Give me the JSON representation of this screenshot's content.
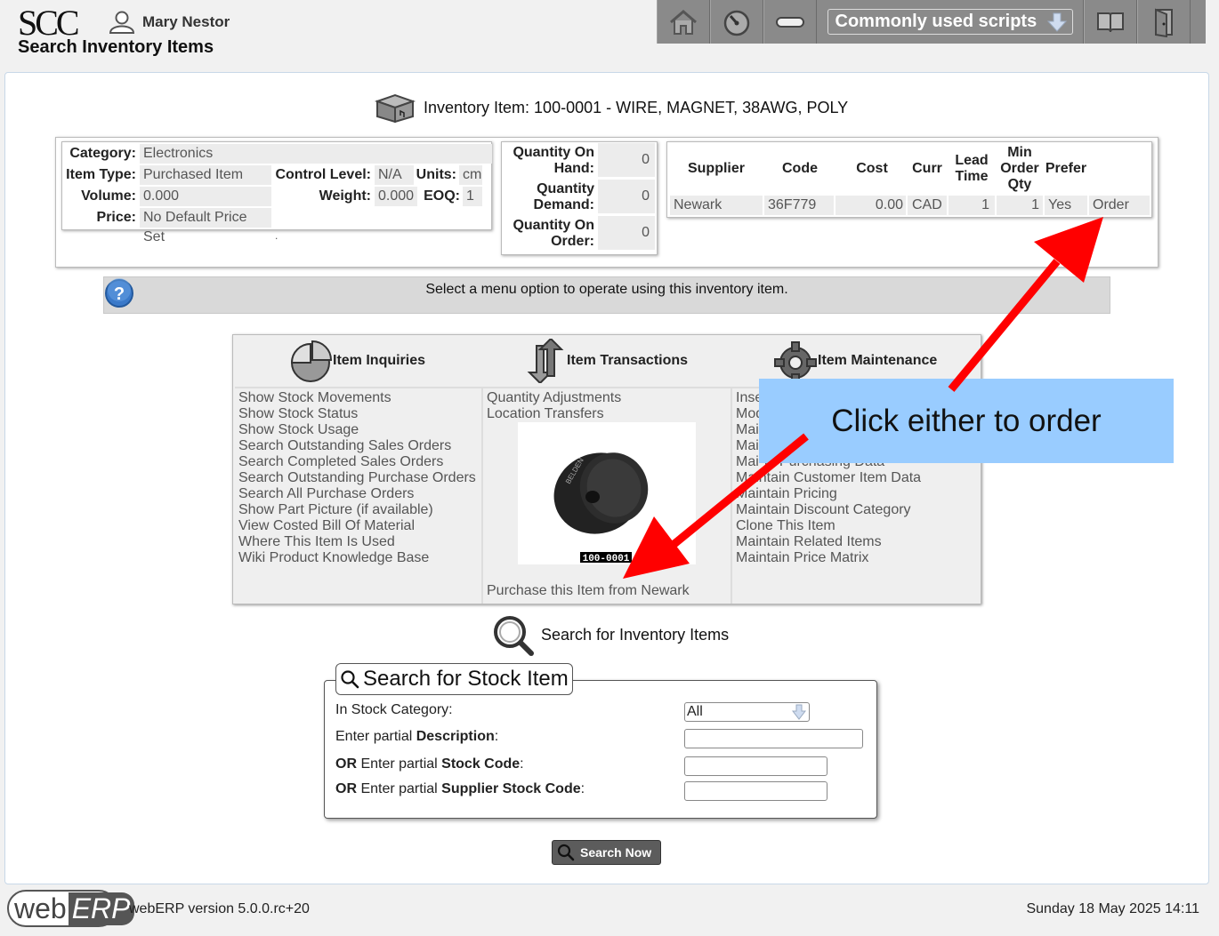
{
  "header": {
    "logo": "SCC",
    "user_name": "Mary Nestor",
    "page_title": "Search Inventory Items",
    "scripts_label": "Commonly used scripts"
  },
  "item": {
    "title": "Inventory Item: 100-0001 - WIRE, MAGNET, 38AWG, POLY",
    "category_label": "Category:",
    "category": "Electronics",
    "item_type_label": "Item Type:",
    "item_type": "Purchased Item",
    "control_level_label": "Control Level:",
    "control_level": "N/A",
    "units_label": "Units:",
    "units": "cm",
    "volume_label": "Volume:",
    "volume": "0.000",
    "weight_label": "Weight:",
    "weight": "0.000",
    "eoq_label": "EOQ:",
    "eoq": "1",
    "price_label": "Price:",
    "price": "No Default Price Set",
    "dot": "."
  },
  "quantities": [
    {
      "label1": "Quantity On",
      "label2": "Hand:",
      "value": "0"
    },
    {
      "label1": "Quantity",
      "label2": "Demand:",
      "value": "0"
    },
    {
      "label1": "Quantity On",
      "label2": "Order:",
      "value": "0"
    }
  ],
  "suppliers": {
    "headers": {
      "supplier": "Supplier",
      "code": "Code",
      "cost": "Cost",
      "curr": "Curr",
      "lead1": "Lead",
      "lead2": "Time",
      "min1": "Min",
      "min2": "Order",
      "min3": "Qty",
      "prefer": "Prefer"
    },
    "row": {
      "supplier": "Newark",
      "code": "36F779",
      "cost": "0.00",
      "curr": "CAD",
      "lead": "1",
      "min": "1",
      "prefer": "Yes",
      "order": "Order"
    }
  },
  "message": "Select a menu option to operate using this inventory item.",
  "menu": {
    "inquiries": {
      "title": "Item Inquiries",
      "items": [
        "Show Stock Movements",
        "Show Stock Status",
        "Show Stock Usage",
        "Search Outstanding Sales Orders",
        "Search Completed Sales Orders",
        "Search Outstanding Purchase Orders",
        "Search All Purchase Orders",
        "Show Part Picture (if available)",
        "View Costed Bill Of Material",
        "Where This Item Is Used",
        "Wiki Product Knowledge Base"
      ]
    },
    "transactions": {
      "title": "Item Transactions",
      "items": [
        "Quantity Adjustments",
        "Location Transfers"
      ],
      "picture_caption": "100-0001",
      "spool_brand": "BELDEN",
      "purchase": "Purchase this Item from Newark"
    },
    "maintenance": {
      "title": "Item Maintenance",
      "items": [
        "Inse",
        "Mod",
        "Mai",
        "Mai",
        "Mai",
        "Maintain Customer Item Data",
        "Maintain Pricing",
        "Maintain Discount Category",
        "Clone This Item",
        "Maintain Related Items",
        "Maintain Price Matrix"
      ],
      "partial_item": "in Purchasing Data"
    }
  },
  "search": {
    "link": "Search for Inventory Items",
    "legend": "Search for Stock Item",
    "category_label": "In Stock Category:",
    "category_value": "All",
    "desc_prefix": "Enter partial ",
    "desc_bold": "Description",
    "code_or": "OR",
    "code_mid": " Enter partial ",
    "code_bold": "Stock Code",
    "sup_or": "OR",
    "sup_mid": " Enter partial ",
    "sup_bold": "Supplier Stock Code",
    "colon": ":",
    "button": "Search Now"
  },
  "callout": "Click either to order",
  "footer": {
    "logo_web": "web",
    "logo_erp": "ERP",
    "version": "webERP version 5.0.0.rc+20",
    "date": "Sunday 18 May 2025 14:11"
  },
  "colors": {
    "toolbar": "#8a8a8a",
    "callout": "#99ccff",
    "arrow": "#ff0000"
  }
}
